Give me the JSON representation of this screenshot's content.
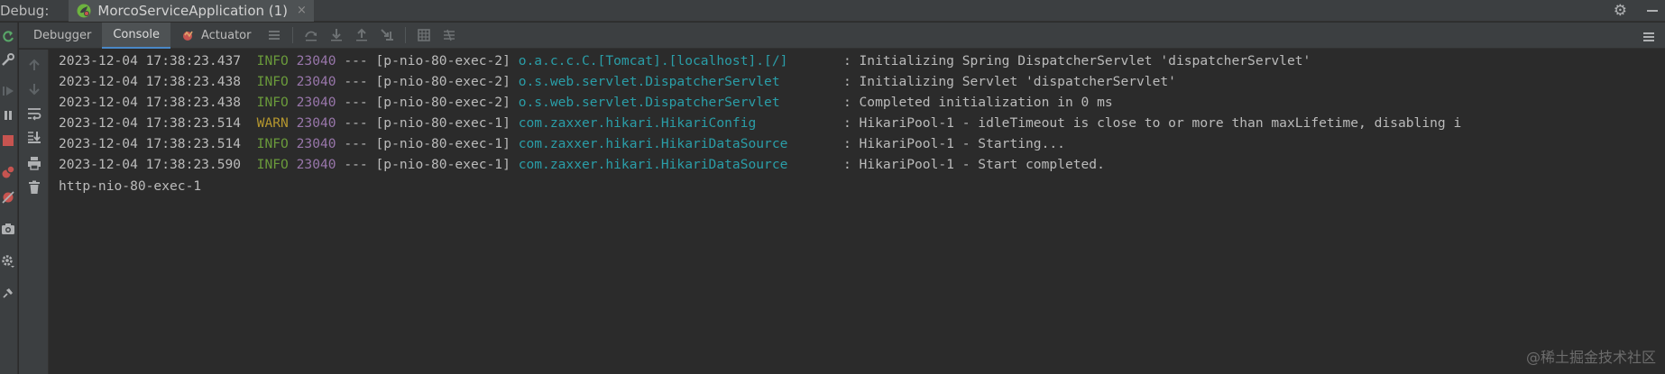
{
  "header": {
    "debug_label": "Debug:",
    "run_tab_label": "MorcoServiceApplication (1)",
    "close_symbol": "×"
  },
  "tabs": [
    {
      "label": "Debugger"
    },
    {
      "label": "Console"
    },
    {
      "label": "Actuator"
    }
  ],
  "log_lines": [
    {
      "ts": "2023-12-04 17:38:23.437",
      "level": "INFO",
      "pid": "23040",
      "sep": "---",
      "thread": "[p-nio-80-exec-2]",
      "logger": "o.a.c.c.C.[Tomcat].[localhost].[/]",
      "msg": ": Initializing Spring DispatcherServlet 'dispatcherServlet'"
    },
    {
      "ts": "2023-12-04 17:38:23.438",
      "level": "INFO",
      "pid": "23040",
      "sep": "---",
      "thread": "[p-nio-80-exec-2]",
      "logger": "o.s.web.servlet.DispatcherServlet",
      "msg": ": Initializing Servlet 'dispatcherServlet'"
    },
    {
      "ts": "2023-12-04 17:38:23.438",
      "level": "INFO",
      "pid": "23040",
      "sep": "---",
      "thread": "[p-nio-80-exec-2]",
      "logger": "o.s.web.servlet.DispatcherServlet",
      "msg": ": Completed initialization in 0 ms"
    },
    {
      "ts": "2023-12-04 17:38:23.514",
      "level": "WARN",
      "pid": "23040",
      "sep": "---",
      "thread": "[p-nio-80-exec-1]",
      "logger": "com.zaxxer.hikari.HikariConfig",
      "msg": ": HikariPool-1 - idleTimeout is close to or more than maxLifetime, disabling i"
    },
    {
      "ts": "2023-12-04 17:38:23.514",
      "level": "INFO",
      "pid": "23040",
      "sep": "---",
      "thread": "[p-nio-80-exec-1]",
      "logger": "com.zaxxer.hikari.HikariDataSource",
      "msg": ": HikariPool-1 - Starting..."
    },
    {
      "ts": "2023-12-04 17:38:23.590",
      "level": "INFO",
      "pid": "23040",
      "sep": "---",
      "thread": "[p-nio-80-exec-1]",
      "logger": "com.zaxxer.hikari.HikariDataSource",
      "msg": ": HikariPool-1 - Start completed."
    }
  ],
  "plain_line": "http-nio-80-exec-1",
  "watermark": "@稀土掘金技术社区",
  "colors": {
    "info": "#6a9a3b",
    "warn": "#b4962e",
    "pid": "#9876aa",
    "logger": "#2a9ea8",
    "text": "#bbbbbb",
    "background": "#2b2b2b",
    "panel": "#3c3f41"
  },
  "icons": {
    "left_toolbar": [
      "rerun-icon",
      "wrench-icon",
      "resume-icon",
      "pause-icon",
      "stop-icon",
      "view-breakpoints-icon",
      "mute-breakpoints-icon",
      "camera-icon",
      "settings-icon",
      "pin-icon"
    ],
    "console_toolbar": [
      "up-arrow-icon",
      "down-arrow-icon",
      "soft-wrap-icon",
      "scroll-to-end-icon",
      "print-icon",
      "trash-icon"
    ],
    "top_toolbar": [
      "layout-icon",
      "step-over-icon",
      "step-into-icon",
      "step-out-icon",
      "run-to-cursor-icon",
      "evaluate-icon",
      "trace-icon",
      "restore-layout-icon"
    ]
  }
}
